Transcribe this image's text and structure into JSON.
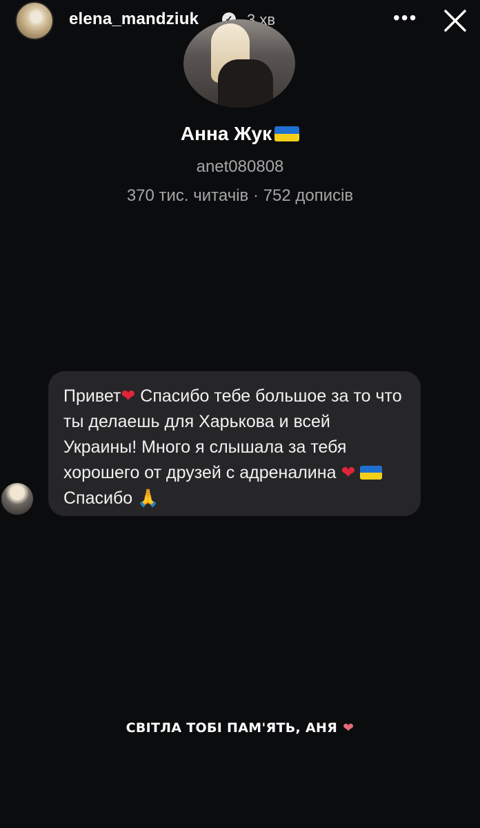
{
  "story": {
    "username": "elena_mandziuk",
    "time": "3 хв",
    "more_icon": "more-horizontal-icon",
    "close_icon": "close-icon"
  },
  "profile": {
    "name": "Анна Жук",
    "handle": "anet080808",
    "stats": "370 тис. читачів · 752 дописів"
  },
  "message": {
    "parts": {
      "p1": "Привет",
      "p2": " Спасибо тебе большое за то что ты делаешь для Харькова и всей Украины! Много я слышала за тебя хорошего от друзей с адреналина ",
      "p3": " Спасибо "
    },
    "heart": "❤",
    "pray": "🙏"
  },
  "caption": {
    "text": "СВІТЛА ТОБІ ПАМ'ЯТЬ, АНЯ",
    "heart": "❤"
  },
  "colors": {
    "background": "#0b0c0e",
    "bubble": "#262628",
    "muted_text": "#a6a6a6"
  }
}
